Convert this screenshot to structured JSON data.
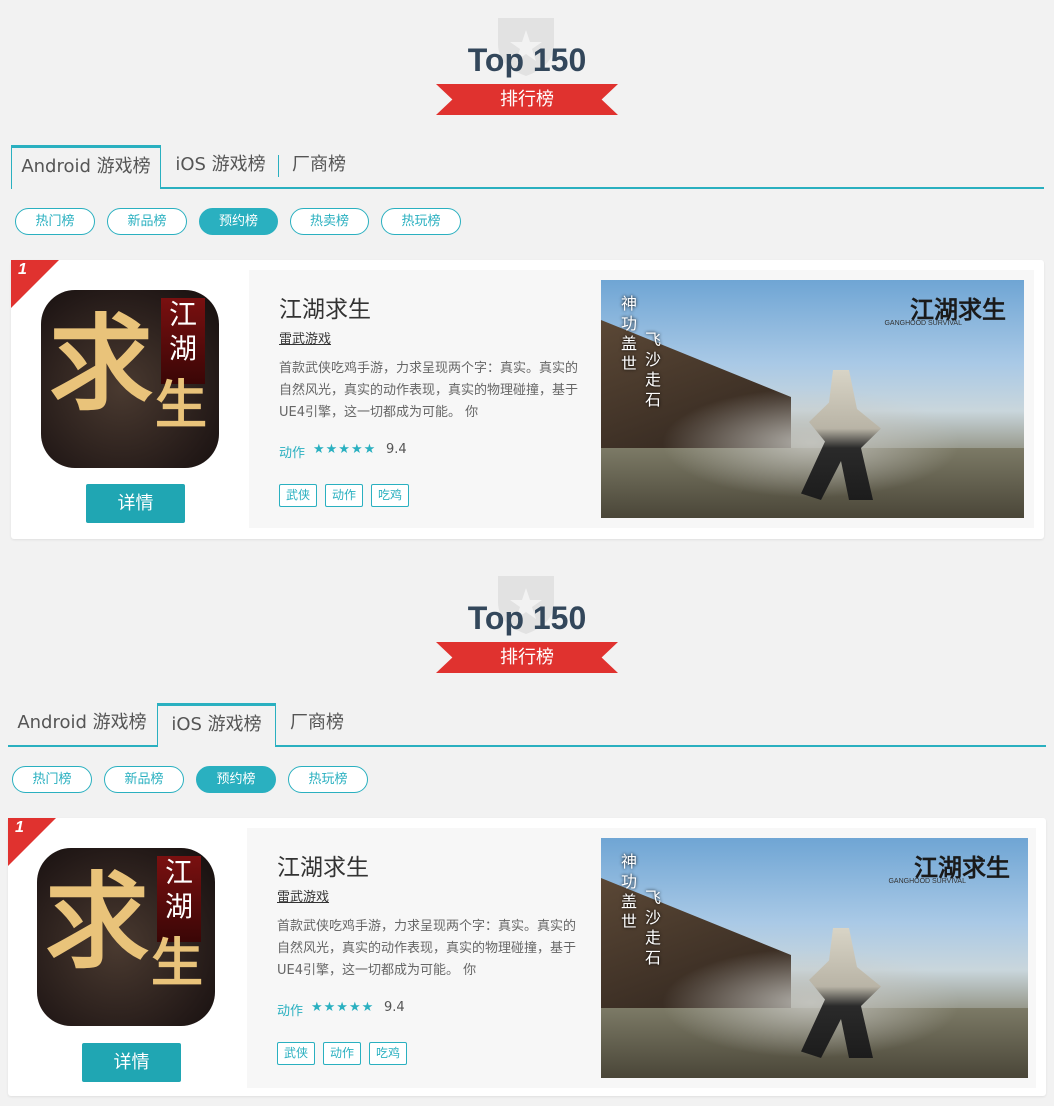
{
  "panels": [
    {
      "title": "Top 150",
      "ribbon": "排行榜",
      "tabs": [
        "Android 游戏榜",
        "iOS 游戏榜",
        "厂商榜"
      ],
      "active_tab": 0,
      "filters": [
        "热门榜",
        "新品榜",
        "预约榜",
        "热卖榜",
        "热玩榜"
      ],
      "active_filter": "预约榜",
      "card": {
        "rank": "1",
        "icon_big": "求",
        "icon_small": "生",
        "icon_vertical": "江湖",
        "detail_label": "详情",
        "name": "江湖求生",
        "developer": "雷武游戏",
        "description": "首款武侠吃鸡手游，力求呈现两个字：真实。真实的自然风光，真实的动作表现，真实的物理碰撞，基于UE4引擎，这一切都成为可能。 你",
        "genre": "动作",
        "stars": "★★★★★",
        "rating": "9.4",
        "tags": [
          "武侠",
          "动作",
          "吃鸡"
        ],
        "screenshot": {
          "vtext1": "神功盖世",
          "vtext2": "飞沙走石",
          "logo": "江湖求生",
          "logo_sub": "GANGHOOD SURVIVAL"
        }
      }
    },
    {
      "title": "Top 150",
      "ribbon": "排行榜",
      "tabs": [
        "Android 游戏榜",
        "iOS 游戏榜",
        "厂商榜"
      ],
      "active_tab": 1,
      "filters": [
        "热门榜",
        "新品榜",
        "预约榜",
        "热玩榜"
      ],
      "active_filter": "预约榜",
      "card": {
        "rank": "1",
        "icon_big": "求",
        "icon_small": "生",
        "icon_vertical": "江湖",
        "detail_label": "详情",
        "name": "江湖求生",
        "developer": "雷武游戏",
        "description": "首款武侠吃鸡手游，力求呈现两个字：真实。真实的自然风光，真实的动作表现，真实的物理碰撞，基于UE4引擎，这一切都成为可能。 你",
        "genre": "动作",
        "stars": "★★★★★",
        "rating": "9.4",
        "tags": [
          "武侠",
          "动作",
          "吃鸡"
        ],
        "screenshot": {
          "vtext1": "神功盖世",
          "vtext2": "飞沙走石",
          "logo": "江湖求生",
          "logo_sub": "GANGHOOD SURVIVAL"
        }
      }
    }
  ],
  "colors": {
    "accent": "#2ab0c0",
    "ribbon": "#e0322f",
    "title": "#33475b"
  }
}
